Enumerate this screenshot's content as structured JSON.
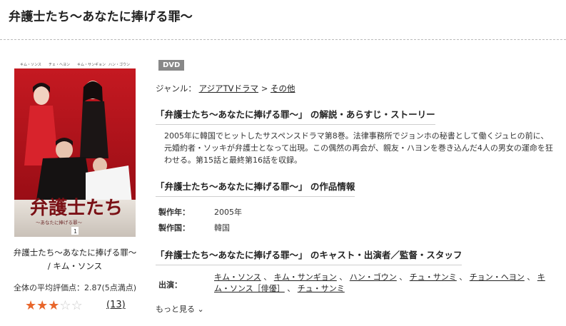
{
  "page": {
    "title": "弁護士たち〜あなたに捧げる罪〜"
  },
  "cover": {
    "actor_names": [
      "キム・ソンス",
      "チェ・ヘヨン",
      "キム・サンギョン",
      "ハン・ゴウン"
    ],
    "logo_text": "弁護士たち",
    "logo_subtitle": "〜あなたに捧げる罪〜",
    "volume": "1"
  },
  "caption": {
    "line1": "弁護士たち〜あなたに捧げる罪〜",
    "line2": "/ キム・ソンス"
  },
  "rating": {
    "text": "全体の平均評価点：2.87(5点満点)",
    "stars_filled": 3,
    "stars_total": 6,
    "count": "(13)"
  },
  "badge": "DVD",
  "genre": {
    "label": "ジャンル：",
    "links": [
      "アジアTVドラマ",
      "その他"
    ],
    "separator": ">"
  },
  "sections": {
    "synopsis_heading": "「弁護士たち〜あなたに捧げる罪〜」 の解説・あらすじ・ストーリー",
    "synopsis": "2005年に韓国でヒットしたサスペンスドラマ第8巻。法律事務所でジョンホの秘書として働くジュヒの前に、元婚約者・ソッキが弁護士となって出現。この偶然の再会が、親友・ハヨンを巻き込んだ4人の男女の運命を狂わせる。第15話と最終第16話を収録。",
    "info_heading": "「弁護士たち〜あなたに捧げる罪〜」 の作品情報",
    "info": [
      {
        "label": "製作年：",
        "value": "2005年"
      },
      {
        "label": "製作国：",
        "value": "韓国"
      }
    ],
    "cast_heading": "「弁護士たち〜あなたに捧げる罪〜」 のキャスト・出演者／監督・スタッフ",
    "cast_label": "出演：",
    "cast": [
      "キム・ソンス",
      "キム・サンギョン",
      "ハン・ゴウン",
      "チュ・サンミ",
      "チョン・ヘヨン",
      "キム・ソンス［俳優］",
      "チュ・サンミ"
    ],
    "more": "もっと見る"
  },
  "colors": {
    "accent_star": "#e8662b",
    "cover_red": "#b00d18",
    "badge_gray": "#888888"
  }
}
